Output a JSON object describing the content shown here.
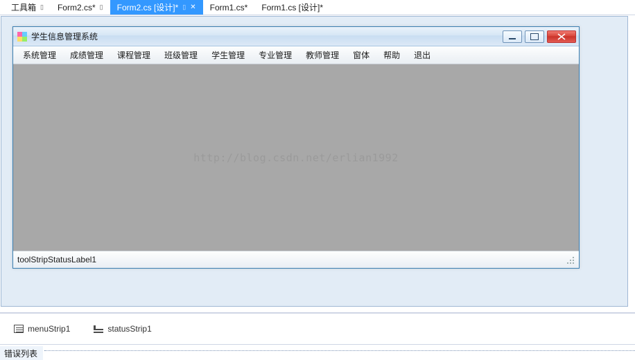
{
  "ide_tabs": [
    {
      "label": "工具箱",
      "pinned": true,
      "active": false,
      "closable": false
    },
    {
      "label": "Form2.cs*",
      "pinned": true,
      "active": false,
      "closable": false
    },
    {
      "label": "Form2.cs [设计]*",
      "pinned": true,
      "active": true,
      "closable": true
    },
    {
      "label": "Form1.cs*",
      "pinned": false,
      "active": false,
      "closable": false
    },
    {
      "label": "Form1.cs [设计]*",
      "pinned": false,
      "active": false,
      "closable": false
    }
  ],
  "form": {
    "title": "学生信息管理系统",
    "menu": [
      "系统管理",
      "成绩管理",
      "课程管理",
      "班级管理",
      "学生管理",
      "专业管理",
      "教师管理",
      "窗体",
      "帮助",
      "退出"
    ],
    "status_text": "toolStripStatusLabel1",
    "watermark": "http://blog.csdn.net/erlian1992"
  },
  "tray": [
    {
      "icon": "menu",
      "label": "menuStrip1"
    },
    {
      "icon": "status",
      "label": "statusStrip1"
    }
  ],
  "bottom_tab": "错误列表"
}
